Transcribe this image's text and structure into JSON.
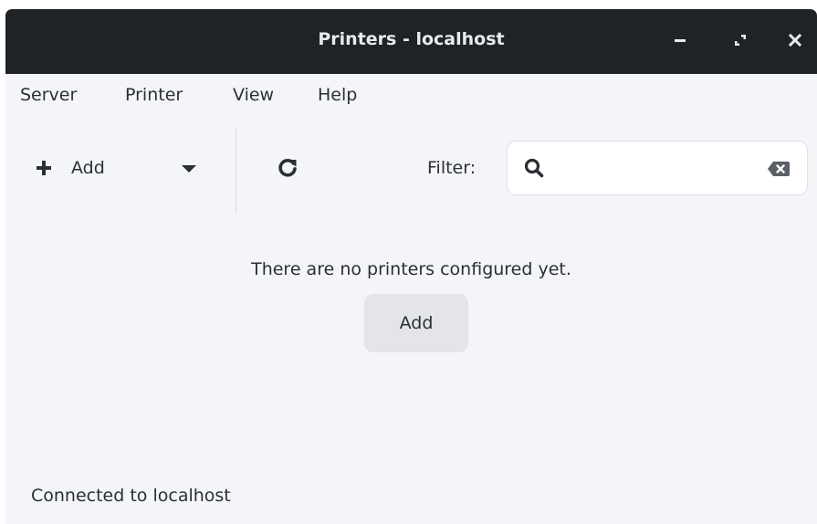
{
  "window": {
    "title": "Printers - localhost"
  },
  "menubar": {
    "items": [
      "Server",
      "Printer",
      "View",
      "Help"
    ]
  },
  "toolbar": {
    "add_label": "Add",
    "add_icon": "plus-icon",
    "dropdown_icon": "caret-down-icon",
    "refresh_icon": "refresh-icon",
    "filter_label": "Filter:",
    "filter_value": "",
    "filter_placeholder": ""
  },
  "main": {
    "empty_message": "There are no printers configured yet.",
    "add_button_label": "Add"
  },
  "statusbar": {
    "text": "Connected to localhost"
  },
  "colors": {
    "titlebar_bg": "#1f2325",
    "window_bg": "#f4f5f9",
    "text": "#2b2f33",
    "button_bg": "#e3e5eb"
  }
}
